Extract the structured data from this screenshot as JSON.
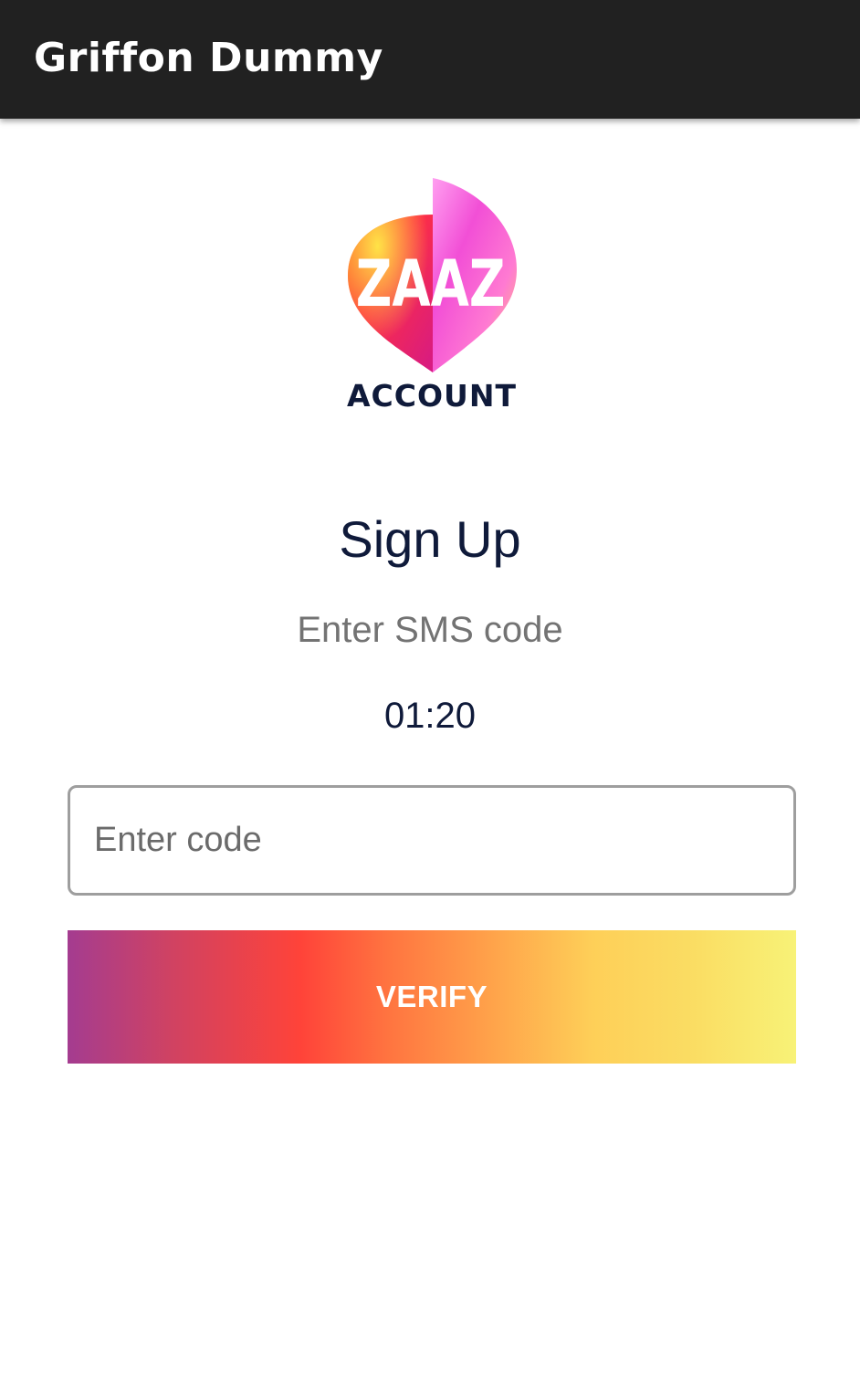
{
  "app_bar": {
    "title": "Griffon Dummy"
  },
  "logo": {
    "wordmark": "ZAAZ",
    "caption": "ACCOUNT"
  },
  "form": {
    "heading": "Sign Up",
    "subtitle": "Enter SMS code",
    "timer": "01:20",
    "code_input": {
      "placeholder": "Enter code",
      "value": ""
    },
    "verify_label": "VERIFY"
  },
  "colors": {
    "app_bar": "#212121",
    "heading_text": "#0f1a3a",
    "subtitle_text": "#737373",
    "input_border": "#9e9e9e",
    "button_gradient": [
      "#a43c90",
      "#ff4339",
      "#ffa24a",
      "#f8f277"
    ]
  },
  "icons": {
    "logo": "zaaz-speech-bubble-logo"
  }
}
